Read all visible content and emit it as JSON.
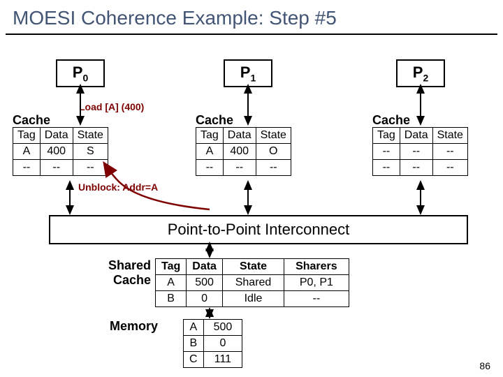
{
  "title": "MOESI Coherence Example: Step #5",
  "procs": [
    {
      "name": "P",
      "sub": "0"
    },
    {
      "name": "P",
      "sub": "1"
    },
    {
      "name": "P",
      "sub": "2"
    }
  ],
  "load_label": "Load [A]  (400)",
  "unblock_label": "Unblock: Addr=A",
  "cache_header": "Cache",
  "cache_cols": [
    "Tag",
    "Data",
    "State"
  ],
  "caches": [
    {
      "rows": [
        [
          "A",
          "400",
          "S"
        ],
        [
          "--",
          "--",
          "--"
        ]
      ]
    },
    {
      "rows": [
        [
          "A",
          "400",
          "O"
        ],
        [
          "--",
          "--",
          "--"
        ]
      ]
    },
    {
      "rows": [
        [
          "--",
          "--",
          "--"
        ],
        [
          "--",
          "--",
          "--"
        ]
      ]
    }
  ],
  "interconnect": "Point-to-Point Interconnect",
  "shared_label": "Shared\nCache",
  "shared_cols": [
    "Tag",
    "Data",
    "State",
    "Sharers"
  ],
  "shared_rows": [
    [
      "A",
      "500",
      "Shared",
      "P0, P1"
    ],
    [
      "B",
      "0",
      "Idle",
      "--"
    ]
  ],
  "memory_label": "Memory",
  "memory_rows": [
    [
      "A",
      "500"
    ],
    [
      "B",
      "0"
    ],
    [
      "C",
      "111"
    ]
  ],
  "slide_num": "86"
}
